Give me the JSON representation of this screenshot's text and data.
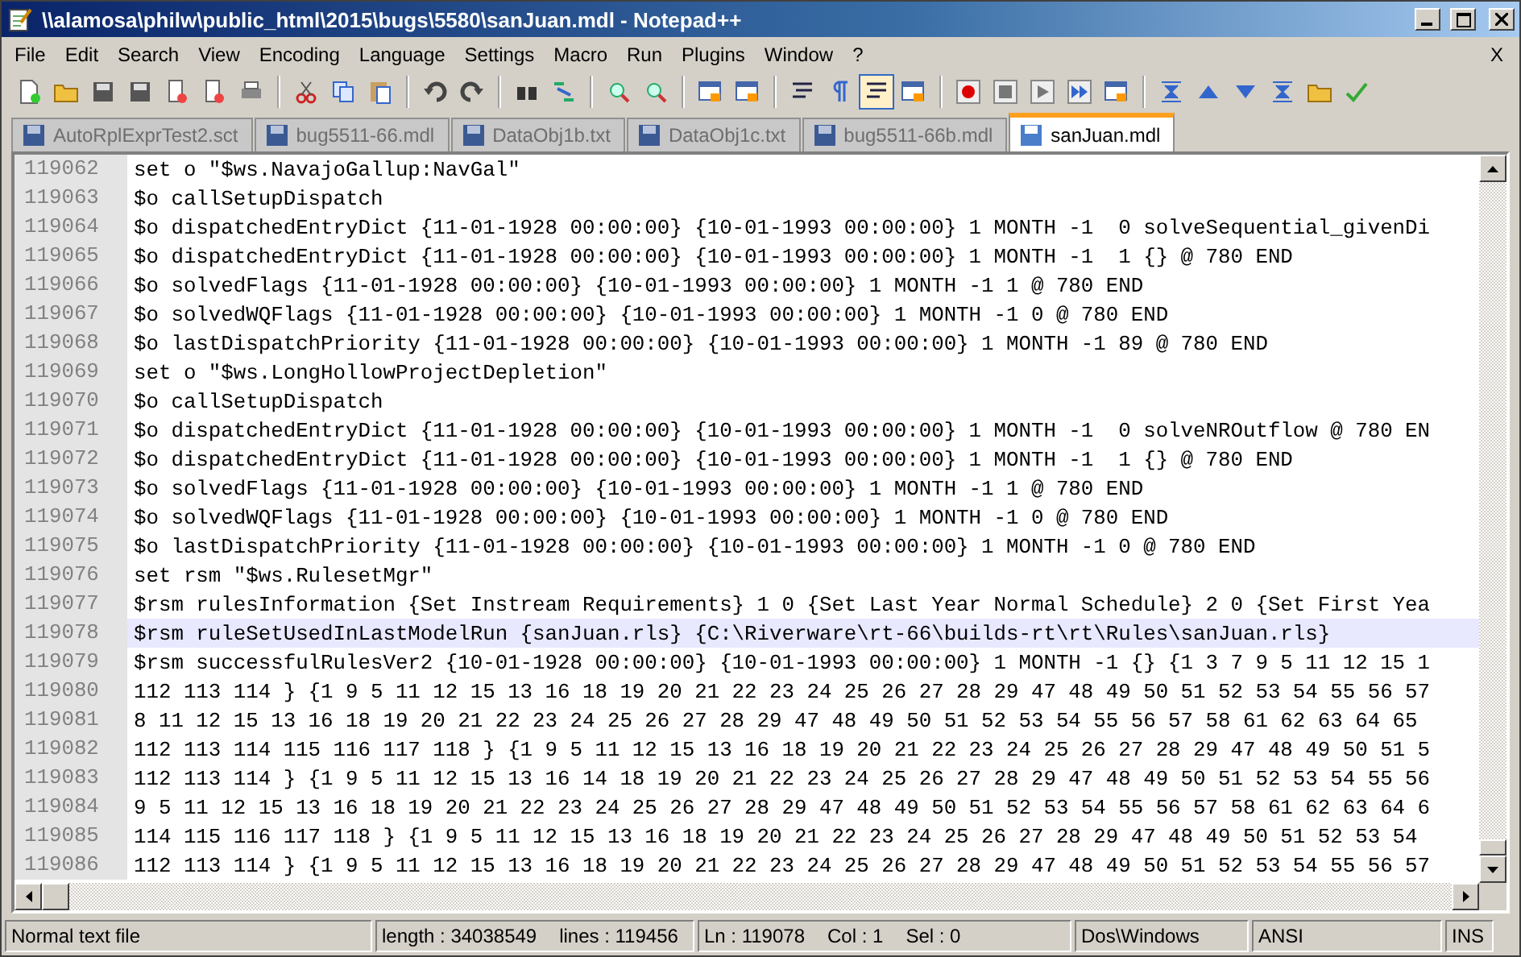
{
  "window": {
    "title": "\\\\alamosa\\philw\\public_html\\2015\\bugs\\5580\\sanJuan.mdl - Notepad++"
  },
  "menu": {
    "items": [
      "File",
      "Edit",
      "Search",
      "View",
      "Encoding",
      "Language",
      "Settings",
      "Macro",
      "Run",
      "Plugins",
      "Window",
      "?"
    ],
    "close_document": "X"
  },
  "toolbar": [
    {
      "pressed": false
    },
    {
      "pressed": false
    },
    {
      "pressed": false
    },
    {
      "pressed": false
    },
    {
      "pressed": false
    },
    {
      "pressed": false
    },
    {
      "pressed": false
    },
    {
      "pressed": false
    },
    {
      "pressed": false
    },
    {
      "pressed": false
    },
    {
      "pressed": false
    },
    {
      "pressed": false
    },
    {
      "pressed": false
    },
    {
      "pressed": false
    },
    {
      "pressed": false
    },
    {
      "pressed": false
    },
    {
      "pressed": false
    },
    {
      "pressed": false
    },
    {
      "pressed": false
    },
    {
      "pressed": false
    },
    {
      "pressed": true
    },
    {
      "pressed": false
    },
    {
      "pressed": false
    },
    {
      "pressed": false
    },
    {
      "pressed": false
    },
    {
      "pressed": false
    },
    {
      "pressed": false
    },
    {
      "pressed": false
    },
    {
      "pressed": false
    },
    {
      "pressed": false
    },
    {
      "pressed": false
    },
    {
      "pressed": false
    },
    {
      "pressed": false
    }
  ],
  "tabs": [
    {
      "label": "AutoRplExprTest2.sct",
      "selected": false
    },
    {
      "label": "bug5511-66.mdl",
      "selected": false
    },
    {
      "label": "DataObj1b.txt",
      "selected": false
    },
    {
      "label": "DataObj1c.txt",
      "selected": false
    },
    {
      "label": "bug5511-66b.mdl",
      "selected": false
    },
    {
      "label": "sanJuan.mdl",
      "selected": true
    }
  ],
  "editor": {
    "lines": [
      {
        "number": "119062",
        "text": "set o \"$ws.NavajoGallup:NavGal\"",
        "current": false
      },
      {
        "number": "119063",
        "text": "$o callSetupDispatch",
        "current": false
      },
      {
        "number": "119064",
        "text": "$o dispatchedEntryDict {11-01-1928 00:00:00} {10-01-1993 00:00:00} 1 MONTH -1  0 solveSequential_givenDi",
        "current": false
      },
      {
        "number": "119065",
        "text": "$o dispatchedEntryDict {11-01-1928 00:00:00} {10-01-1993 00:00:00} 1 MONTH -1  1 {} @ 780 END",
        "current": false
      },
      {
        "number": "119066",
        "text": "$o solvedFlags {11-01-1928 00:00:00} {10-01-1993 00:00:00} 1 MONTH -1 1 @ 780 END",
        "current": false
      },
      {
        "number": "119067",
        "text": "$o solvedWQFlags {11-01-1928 00:00:00} {10-01-1993 00:00:00} 1 MONTH -1 0 @ 780 END",
        "current": false
      },
      {
        "number": "119068",
        "text": "$o lastDispatchPriority {11-01-1928 00:00:00} {10-01-1993 00:00:00} 1 MONTH -1 89 @ 780 END",
        "current": false
      },
      {
        "number": "119069",
        "text": "set o \"$ws.LongHollowProjectDepletion\"",
        "current": false
      },
      {
        "number": "119070",
        "text": "$o callSetupDispatch",
        "current": false
      },
      {
        "number": "119071",
        "text": "$o dispatchedEntryDict {11-01-1928 00:00:00} {10-01-1993 00:00:00} 1 MONTH -1  0 solveNROutflow @ 780 EN",
        "current": false
      },
      {
        "number": "119072",
        "text": "$o dispatchedEntryDict {11-01-1928 00:00:00} {10-01-1993 00:00:00} 1 MONTH -1  1 {} @ 780 END",
        "current": false
      },
      {
        "number": "119073",
        "text": "$o solvedFlags {11-01-1928 00:00:00} {10-01-1993 00:00:00} 1 MONTH -1 1 @ 780 END",
        "current": false
      },
      {
        "number": "119074",
        "text": "$o solvedWQFlags {11-01-1928 00:00:00} {10-01-1993 00:00:00} 1 MONTH -1 0 @ 780 END",
        "current": false
      },
      {
        "number": "119075",
        "text": "$o lastDispatchPriority {11-01-1928 00:00:00} {10-01-1993 00:00:00} 1 MONTH -1 0 @ 780 END",
        "current": false
      },
      {
        "number": "119076",
        "text": "set rsm \"$ws.RulesetMgr\"",
        "current": false
      },
      {
        "number": "119077",
        "text": "$rsm rulesInformation {Set Instream Requirements} 1 0 {Set Last Year Normal Schedule} 2 0 {Set First Yea",
        "current": false
      },
      {
        "number": "119078",
        "text": "$rsm ruleSetUsedInLastModelRun {sanJuan.rls} {C:\\Riverware\\rt-66\\builds-rt\\rt\\Rules\\sanJuan.rls}",
        "current": true
      },
      {
        "number": "119079",
        "text": "$rsm successfulRulesVer2 {10-01-1928 00:00:00} {10-01-1993 00:00:00} 1 MONTH -1 {} {1 3 7 9 5 11 12 15 1",
        "current": false
      },
      {
        "number": "119080",
        "text": "112 113 114 } {1 9 5 11 12 15 13 16 18 19 20 21 22 23 24 25 26 27 28 29 47 48 49 50 51 52 53 54 55 56 57",
        "current": false
      },
      {
        "number": "119081",
        "text": "8 11 12 15 13 16 18 19 20 21 22 23 24 25 26 27 28 29 47 48 49 50 51 52 53 54 55 56 57 58 61 62 63 64 65",
        "current": false
      },
      {
        "number": "119082",
        "text": "112 113 114 115 116 117 118 } {1 9 5 11 12 15 13 16 18 19 20 21 22 23 24 25 26 27 28 29 47 48 49 50 51 5",
        "current": false
      },
      {
        "number": "119083",
        "text": "112 113 114 } {1 9 5 11 12 15 13 16 14 18 19 20 21 22 23 24 25 26 27 28 29 47 48 49 50 51 52 53 54 55 56",
        "current": false
      },
      {
        "number": "119084",
        "text": "9 5 11 12 15 13 16 18 19 20 21 22 23 24 25 26 27 28 29 47 48 49 50 51 52 53 54 55 56 57 58 61 62 63 64 6",
        "current": false
      },
      {
        "number": "119085",
        "text": "114 115 116 117 118 } {1 9 5 11 12 15 13 16 18 19 20 21 22 23 24 25 26 27 28 29 47 48 49 50 51 52 53 54",
        "current": false
      },
      {
        "number": "119086",
        "text": "112 113 114 } {1 9 5 11 12 15 13 16 18 19 20 21 22 23 24 25 26 27 28 29 47 48 49 50 51 52 53 54 55 56 57",
        "current": false
      }
    ]
  },
  "status_bar": {
    "file_type": "Normal text file",
    "length": "length : 34038549",
    "lines": "lines : 119456",
    "line": "Ln : 119078",
    "column": "Col : 1",
    "selection": "Sel : 0",
    "eol": "Dos\\Windows",
    "encoding": "ANSI",
    "mode": "INS"
  }
}
